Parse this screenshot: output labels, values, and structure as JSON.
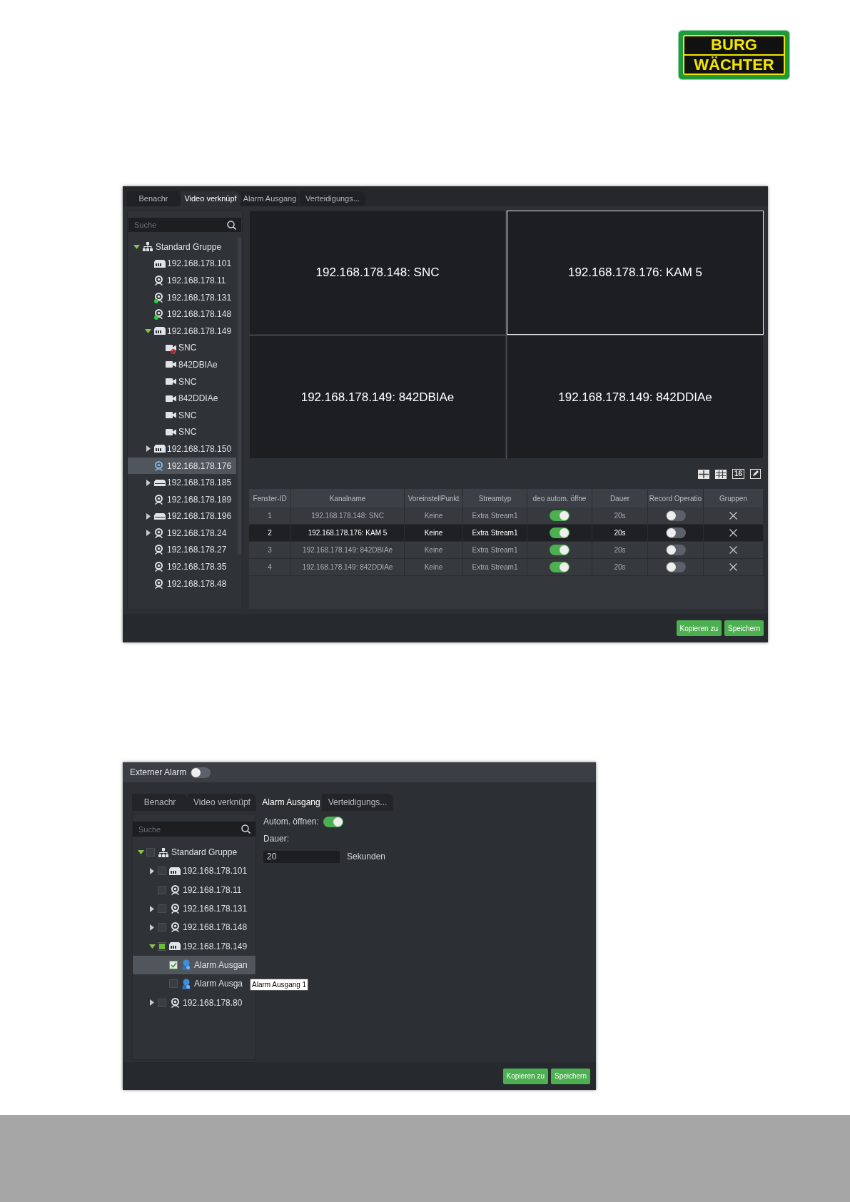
{
  "logo": {
    "line_1": "BURG",
    "line_2": "WÄCHTER"
  },
  "video_link_window": {
    "tabs": [
      {
        "label": "Benachr",
        "selected": false
      },
      {
        "label": "Video verknüpf",
        "selected": true
      },
      {
        "label": "Alarm Ausgang",
        "selected": false
      },
      {
        "label": "Verteidigungs...",
        "selected": false
      }
    ],
    "search": {
      "placeholder": "Suche"
    },
    "tree": [
      {
        "label": "Standard Gruppe",
        "kind": "group",
        "expanded": true,
        "selected": false,
        "children": [
          {
            "label": "192.168.178.101",
            "kind": "nvr",
            "selected": false
          },
          {
            "label": "192.168.178.11",
            "kind": "camera",
            "selected": false
          },
          {
            "label": "192.168.178.131",
            "kind": "camera",
            "online": true,
            "selected": false
          },
          {
            "label": "192.168.178.148",
            "kind": "camera",
            "online": true,
            "selected": false
          },
          {
            "label": "192.168.178.149",
            "kind": "nvr",
            "expanded": true,
            "selected": false,
            "children": [
              {
                "label": "SNC",
                "kind": "channel",
                "offline": true,
                "selected": false
              },
              {
                "label": "842DBIAe",
                "kind": "channel",
                "selected": false
              },
              {
                "label": "SNC",
                "kind": "channel",
                "selected": false
              },
              {
                "label": "842DDIAe",
                "kind": "channel",
                "selected": false
              },
              {
                "label": "SNC",
                "kind": "channel",
                "selected": false
              },
              {
                "label": "SNC",
                "kind": "channel",
                "selected": false
              }
            ]
          },
          {
            "label": "192.168.178.150",
            "kind": "nvr",
            "expanded": false,
            "selected": false
          },
          {
            "label": "192.168.178.176",
            "kind": "camera",
            "selected": true
          },
          {
            "label": "192.168.178.185",
            "kind": "dvr",
            "expanded": false,
            "selected": false
          },
          {
            "label": "192.168.178.189",
            "kind": "camera",
            "selected": false
          },
          {
            "label": "192.168.178.196",
            "kind": "dvr",
            "expanded": false,
            "selected": false
          },
          {
            "label": "192.168.178.24",
            "kind": "camera",
            "expanded": false,
            "selected": false
          },
          {
            "label": "192.168.178.27",
            "kind": "camera",
            "selected": false
          },
          {
            "label": "192.168.178.35",
            "kind": "camera",
            "selected": false
          },
          {
            "label": "192.168.178.48",
            "kind": "camera",
            "selected": false
          }
        ]
      }
    ],
    "video_cells": [
      {
        "label": "192.168.178.148: SNC",
        "selected": false
      },
      {
        "label": "192.168.178.176: KAM 5",
        "selected": true
      },
      {
        "label": "192.168.178.149: 842DBIAe",
        "selected": false
      },
      {
        "label": "192.168.178.149: 842DDIAe",
        "selected": false
      }
    ],
    "layout_buttons": [
      {
        "kind": "grid4"
      },
      {
        "kind": "grid9"
      },
      {
        "kind": "number",
        "label": "16"
      },
      {
        "kind": "edit"
      }
    ],
    "table": {
      "columns": [
        "Fenster-ID",
        "Kanalname",
        "VoreinstellPunkt",
        "Streamtyp",
        "deo autom. öffne",
        "Dauer",
        "Record Operatio",
        "Gruppen"
      ],
      "rows": [
        {
          "fenster_id": "1",
          "kanalname": "192.168.178.148: SNC",
          "voreinstellpunkt": "Keine",
          "streamtyp": "Extra Stream1",
          "video_auto_open": true,
          "dauer": "20s",
          "record_operation": false,
          "selected": false
        },
        {
          "fenster_id": "2",
          "kanalname": "192.168.178.176: KAM 5",
          "voreinstellpunkt": "Keine",
          "streamtyp": "Extra Stream1",
          "video_auto_open": true,
          "dauer": "20s",
          "record_operation": false,
          "selected": true
        },
        {
          "fenster_id": "3",
          "kanalname": "192.168.178.149: 842DBIAe",
          "voreinstellpunkt": "Keine",
          "streamtyp": "Extra Stream1",
          "video_auto_open": true,
          "dauer": "20s",
          "record_operation": false,
          "selected": false
        },
        {
          "fenster_id": "4",
          "kanalname": "192.168.178.149: 842DDIAe",
          "voreinstellpunkt": "Keine",
          "streamtyp": "Extra Stream1",
          "video_auto_open": true,
          "dauer": "20s",
          "record_operation": false,
          "selected": false
        }
      ]
    },
    "buttons": [
      "Kopieren zu",
      "Speichern"
    ]
  },
  "alarm_window": {
    "external_alarm": {
      "label": "Externer Alarm",
      "on": false
    },
    "tabs": [
      {
        "label": "Benachr",
        "selected": false
      },
      {
        "label": "Video verknüpf",
        "selected": false
      },
      {
        "label": "Alarm Ausgang",
        "selected": true
      },
      {
        "label": "Verteidigungs...",
        "selected": false
      }
    ],
    "search": {
      "placeholder": "Suche"
    },
    "tree": [
      {
        "label": "Standard Gruppe",
        "kind": "group",
        "expanded": true,
        "checked": false,
        "selected": false,
        "children": [
          {
            "label": "192.168.178.101",
            "kind": "nvr",
            "expanded": false,
            "checked": false,
            "selected": false
          },
          {
            "label": "192.168.178.11",
            "kind": "camera",
            "checked": false,
            "selected": false
          },
          {
            "label": "192.168.178.131",
            "kind": "camera",
            "expanded": false,
            "checked": false,
            "selected": false
          },
          {
            "label": "192.168.178.148",
            "kind": "camera",
            "expanded": false,
            "checked": false,
            "selected": false
          },
          {
            "label": "192.168.178.149",
            "kind": "nvr",
            "expanded": true,
            "partial": true,
            "selected": false,
            "children": [
              {
                "label": "Alarm Ausgan",
                "kind": "alarm",
                "checked": true,
                "selected": true
              },
              {
                "label": "Alarm Ausga",
                "kind": "alarm",
                "checked": false,
                "selected": false
              }
            ]
          },
          {
            "label": "192.168.178.80",
            "kind": "camera",
            "expanded": false,
            "checked": false,
            "selected": false
          }
        ]
      }
    ],
    "tooltip": "Alarm Ausgang 1",
    "auto_open": {
      "label": "Autom. öffnen:",
      "on": true
    },
    "duration": {
      "label": "Dauer:",
      "value": "20",
      "unit": "Sekunden"
    },
    "buttons": [
      "Kopieren zu",
      "Speichern"
    ]
  }
}
